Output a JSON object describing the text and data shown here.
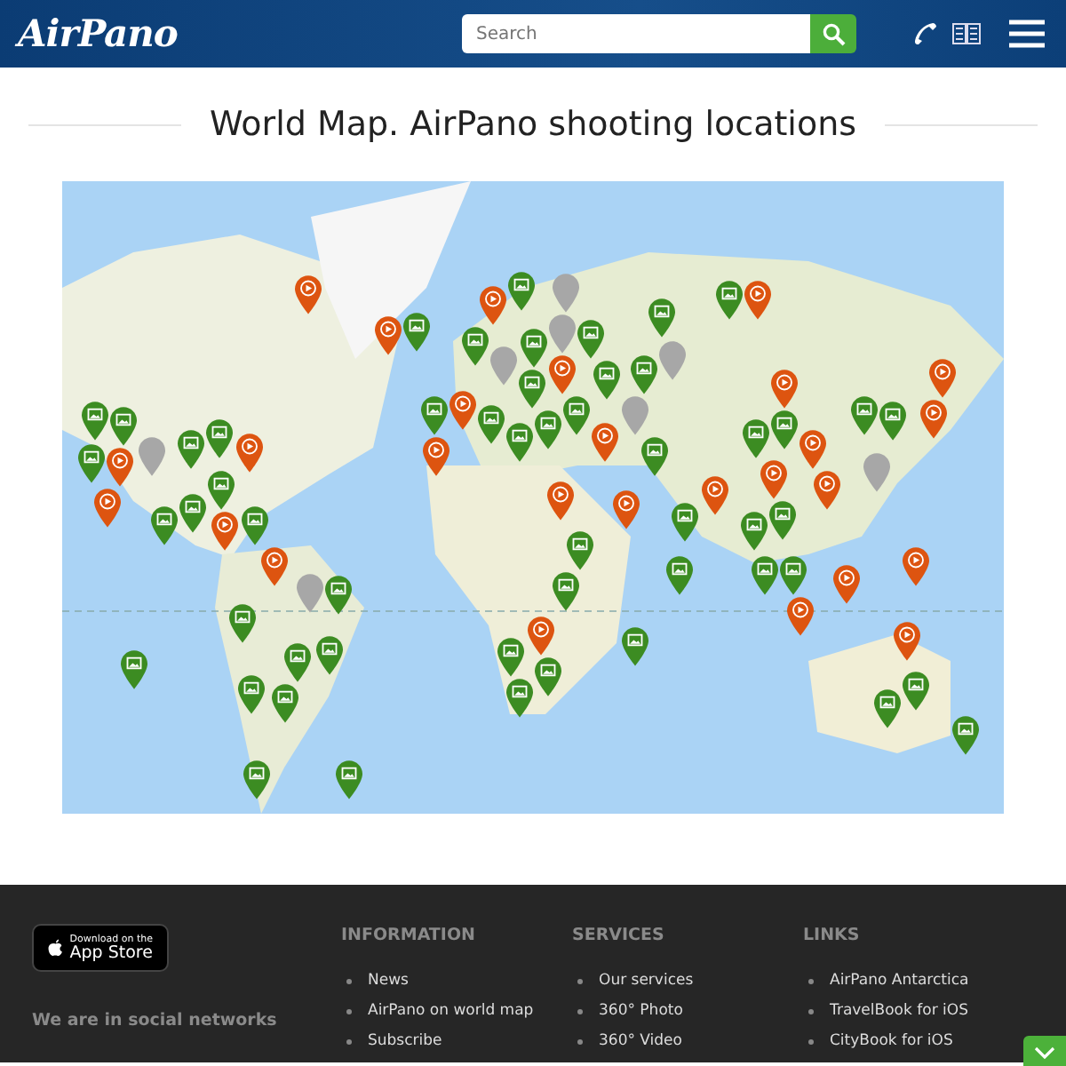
{
  "header": {
    "logo": "AirPano",
    "search": {
      "placeholder": "Search"
    }
  },
  "title": "World Map. AirPano shooting locations",
  "map": {
    "pins": [
      {
        "kind": "video"
      },
      {
        "kind": "video"
      },
      {
        "kind": "video"
      },
      {
        "kind": "video"
      },
      {
        "kind": "video"
      },
      {
        "kind": "video"
      },
      {
        "kind": "video"
      },
      {
        "kind": "video"
      },
      {
        "kind": "video"
      },
      {
        "kind": "video"
      },
      {
        "kind": "video"
      },
      {
        "kind": "video"
      },
      {
        "kind": "video"
      },
      {
        "kind": "video"
      },
      {
        "kind": "video"
      },
      {
        "kind": "video"
      },
      {
        "kind": "video"
      },
      {
        "kind": "video"
      },
      {
        "kind": "video"
      },
      {
        "kind": "video"
      },
      {
        "kind": "video"
      },
      {
        "kind": "video"
      },
      {
        "kind": "video"
      },
      {
        "kind": "video"
      },
      {
        "kind": "video"
      },
      {
        "kind": "video"
      },
      {
        "kind": "video"
      },
      {
        "kind": "photo"
      },
      {
        "kind": "photo"
      },
      {
        "kind": "photo"
      },
      {
        "kind": "photo"
      },
      {
        "kind": "photo"
      },
      {
        "kind": "photo"
      },
      {
        "kind": "photo"
      },
      {
        "kind": "photo"
      },
      {
        "kind": "photo"
      },
      {
        "kind": "photo"
      },
      {
        "kind": "photo"
      },
      {
        "kind": "photo"
      },
      {
        "kind": "photo"
      },
      {
        "kind": "photo"
      },
      {
        "kind": "photo"
      },
      {
        "kind": "photo"
      },
      {
        "kind": "photo"
      },
      {
        "kind": "photo"
      },
      {
        "kind": "photo"
      },
      {
        "kind": "photo"
      },
      {
        "kind": "photo"
      },
      {
        "kind": "photo"
      },
      {
        "kind": "photo"
      },
      {
        "kind": "photo"
      },
      {
        "kind": "photo"
      },
      {
        "kind": "photo"
      },
      {
        "kind": "photo"
      },
      {
        "kind": "photo"
      },
      {
        "kind": "photo"
      },
      {
        "kind": "photo"
      },
      {
        "kind": "photo"
      },
      {
        "kind": "photo"
      },
      {
        "kind": "photo"
      },
      {
        "kind": "photo"
      },
      {
        "kind": "photo"
      },
      {
        "kind": "photo"
      },
      {
        "kind": "photo"
      },
      {
        "kind": "photo"
      },
      {
        "kind": "photo"
      },
      {
        "kind": "photo"
      },
      {
        "kind": "photo"
      },
      {
        "kind": "photo"
      },
      {
        "kind": "photo"
      },
      {
        "kind": "photo"
      },
      {
        "kind": "photo"
      },
      {
        "kind": "photo"
      },
      {
        "kind": "photo"
      },
      {
        "kind": "photo"
      },
      {
        "kind": "photo"
      },
      {
        "kind": "photo"
      },
      {
        "kind": "photo"
      },
      {
        "kind": "photo"
      },
      {
        "kind": "photo"
      },
      {
        "kind": "cluster"
      },
      {
        "kind": "cluster"
      },
      {
        "kind": "cluster"
      },
      {
        "kind": "cluster"
      },
      {
        "kind": "cluster"
      },
      {
        "kind": "cluster"
      },
      {
        "kind": "cluster"
      },
      {
        "kind": "cluster"
      }
    ]
  },
  "footer": {
    "app_badge": {
      "line_1": "Download on the",
      "line_2": "App Store"
    },
    "social_heading": "We are in social networks",
    "columns": [
      {
        "heading": "INFORMATION",
        "links": [
          "News",
          "AirPano on world map",
          "Subscribe"
        ]
      },
      {
        "heading": "SERVICES",
        "links": [
          "Our services",
          "360° Photo",
          "360° Video"
        ]
      },
      {
        "heading": "LINKS",
        "links": [
          "AirPano Antarctica",
          "TravelBook for iOS",
          "CityBook for iOS"
        ]
      }
    ]
  }
}
